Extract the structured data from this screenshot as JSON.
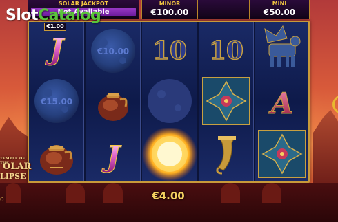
{
  "watermark": {
    "part1": "Slot",
    "part2": "Catalog"
  },
  "jackpots": {
    "solar": {
      "title": "SOLAR JACKPOT",
      "value": "Not Available"
    },
    "minor": {
      "title": "MINOR",
      "value": "€100.00"
    },
    "mini": {
      "title": "MINI",
      "value": "€50.00"
    }
  },
  "bet_tag": "€1.00",
  "reels": [
    [
      "j-symbol",
      "moon-coin",
      "urn-symbol"
    ],
    [
      "moon-coin",
      "urn-symbol",
      "j-symbol"
    ],
    [
      "ten-symbol",
      "moon-blank",
      "sun-wild"
    ],
    [
      "ten-symbol",
      "ornament-tile",
      "horn-symbol"
    ],
    [
      "winged-bull",
      "a-symbol",
      "ornament-tile"
    ]
  ],
  "moon_values": {
    "reel1_row2": "€15.00",
    "reel2_row1": "€10.00"
  },
  "symbols": {
    "ten": "10",
    "a": "A",
    "j": "J"
  },
  "game_logo": {
    "small": "TEMPLE OF THE",
    "line1": "OLAR",
    "line2": "LIPSE"
  },
  "win": "€4.00",
  "balance_fragment": "0"
}
